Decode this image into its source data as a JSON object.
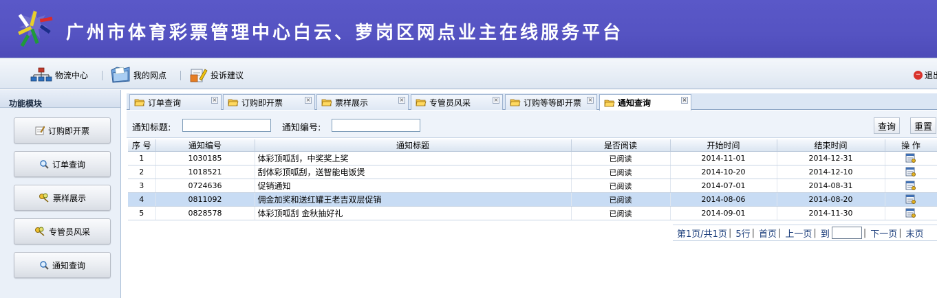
{
  "banner": {
    "title": "广州市体育彩票管理中心白云、萝岗区网点业主在线服务平台"
  },
  "toolbar": {
    "items": [
      {
        "label": "物流中心",
        "icon": "network-icon"
      },
      {
        "label": "我的网点",
        "icon": "folder-blue-icon"
      },
      {
        "label": "投诉建议",
        "icon": "feedback-edit-icon"
      }
    ],
    "exit_label": "退出"
  },
  "left_panel": {
    "title": "功能模块",
    "modules": [
      {
        "label": "订购即开票",
        "icon": "edit-note-icon"
      },
      {
        "label": "订单查询",
        "icon": "magnifier-icon"
      },
      {
        "label": "票样展示",
        "icon": "keys-icon"
      },
      {
        "label": "专管员风采",
        "icon": "keys-icon"
      },
      {
        "label": "通知查询",
        "icon": "magnifier-icon"
      }
    ]
  },
  "tabs": [
    {
      "label": "订单查询",
      "active": false
    },
    {
      "label": "订购即开票",
      "active": false
    },
    {
      "label": "票样展示",
      "active": false
    },
    {
      "label": "专管员风采",
      "active": false
    },
    {
      "label": "订购等等即开票",
      "active": false
    },
    {
      "label": "通知查询",
      "active": true
    }
  ],
  "search": {
    "title_label": "通知标题:",
    "title_value": "",
    "number_label": "通知编号:",
    "number_value": "",
    "query_button": "查询",
    "reset_button": "重置"
  },
  "table": {
    "columns": [
      "序 号",
      "通知编号",
      "通知标题",
      "是否阅读",
      "开始时间",
      "结束时间",
      "操 作"
    ],
    "rows": [
      {
        "seq": "1",
        "number": "1030185",
        "title": "体彩顶呱刮，中奖奖上奖",
        "read": "已阅读",
        "start": "2014-11-01",
        "end": "2014-12-31",
        "highlighted": false
      },
      {
        "seq": "2",
        "number": "1018521",
        "title": "刮体彩顶呱刮，送智能电饭煲",
        "read": "已阅读",
        "start": "2014-10-20",
        "end": "2014-12-10",
        "highlighted": false
      },
      {
        "seq": "3",
        "number": "0724636",
        "title": "促销通知",
        "read": "已阅读",
        "start": "2014-07-01",
        "end": "2014-08-31",
        "highlighted": false
      },
      {
        "seq": "4",
        "number": "0811092",
        "title": "佣金加奖和送红罐王老吉双层促销",
        "read": "已阅读",
        "start": "2014-08-06",
        "end": "2014-08-20",
        "highlighted": true
      },
      {
        "seq": "5",
        "number": "0828578",
        "title": "体彩顶呱刮 金秋抽好礼",
        "read": "已阅读",
        "start": "2014-09-01",
        "end": "2014-11-30",
        "highlighted": false
      }
    ]
  },
  "pager": {
    "page_info": "第1页/共1页",
    "rows_info": "5行",
    "first": "首页",
    "prev": "上一页",
    "goto": "到",
    "goto_value": "",
    "next": "下一页",
    "last": "末页"
  },
  "colors": {
    "banner": "#5553c2",
    "toolbar": "#dde6f1",
    "highlight_row": "#c8dcf4",
    "pager_link": "#1a3c7a"
  }
}
